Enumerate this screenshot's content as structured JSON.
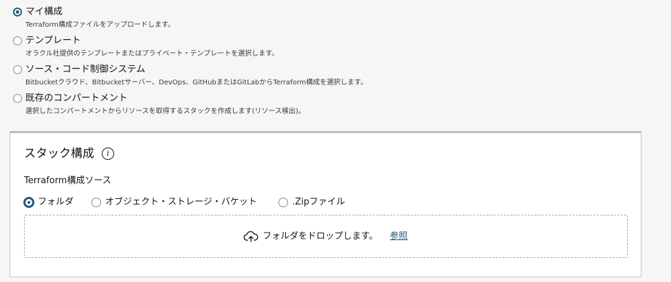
{
  "config_sources": [
    {
      "label": "マイ構成",
      "description": "Terraform構成ファイルをアップロードします。",
      "checked": true
    },
    {
      "label": "テンプレート",
      "description": "オラクル社提供のテンプレートまたはプライベート・テンプレートを選択します。",
      "checked": false
    },
    {
      "label": "ソース・コード制御システム",
      "description": "Bitbucketクラウド、Bitbucketサーバー、DevOps、GitHubまたはGitLabからTerraform構成を選択します。",
      "checked": false
    },
    {
      "label": "既存のコンパートメント",
      "description": "選択したコンパートメントからリソースを取得するスタックを作成します(リソース検出)。",
      "checked": false
    }
  ],
  "panel": {
    "title": "スタック構成",
    "info_icon": "i",
    "source_label": "Terraform構成ソース",
    "source_options": [
      {
        "label": "フォルダ",
        "checked": true
      },
      {
        "label": "オブジェクト・ストレージ・バケット",
        "checked": false
      },
      {
        "label": ".Zipファイル",
        "checked": false
      }
    ],
    "dropzone": {
      "icon": "cloud-upload-icon",
      "text": "フォルダをドロップします。",
      "link": "参照"
    }
  },
  "colors": {
    "accent": "#1f5b7a",
    "background": "#f6f6f6",
    "panel": "#ffffff"
  }
}
